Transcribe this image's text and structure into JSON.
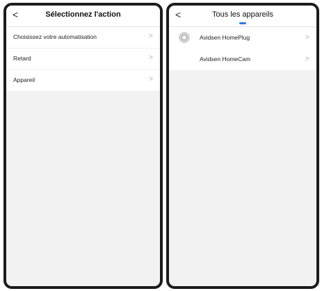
{
  "left_screen": {
    "title": "Sélectionnez l'action",
    "back_glyph": "<",
    "items": [
      {
        "label": "Choisissez votre automatisation"
      },
      {
        "label": "Retard"
      },
      {
        "label": "Appareil"
      }
    ]
  },
  "right_screen": {
    "title": "Tous les appareils",
    "back_glyph": "<",
    "devices": [
      {
        "label": "Avidsen HomePlug",
        "icon": "plug-device-icon"
      },
      {
        "label": "Avidsen HomeCam",
        "icon": ""
      }
    ]
  },
  "chevron_glyph": ">",
  "colors": {
    "accent": "#2f7ce0",
    "frame": "#1c1c1c",
    "background": "#f2f2f2",
    "chevron": "#b5b5b5"
  }
}
